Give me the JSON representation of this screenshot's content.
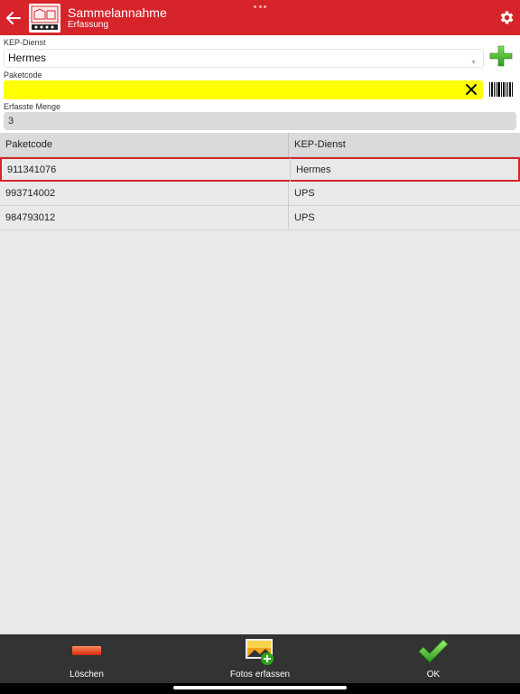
{
  "header": {
    "title": "Sammelannahme",
    "subtitle": "Erfassung",
    "background_color": "#d6242a"
  },
  "form": {
    "kep_label": "KEP-Dienst",
    "kep_value": "Hermes",
    "code_label": "Paketcode",
    "code_value": "",
    "code_highlight_color": "#ffff00",
    "qty_label": "Erfasste Menge",
    "qty_value": "3"
  },
  "table": {
    "columns": [
      "Paketcode",
      "KEP-Dienst"
    ],
    "rows": [
      {
        "code": "911341076",
        "service": "Hermes"
      },
      {
        "code": "993714002",
        "service": "UPS"
      },
      {
        "code": "984793012",
        "service": "UPS"
      }
    ]
  },
  "toolbar": {
    "delete_label": "Löschen",
    "photo_label": "Fotos erfassen",
    "ok_label": "OK"
  },
  "icons": {
    "back": "arrow-left-icon",
    "settings": "gear-icon",
    "add": "plus-icon",
    "clear": "close-icon",
    "barcode": "barcode-icon",
    "delete": "minus-icon",
    "photo": "photo-add-icon",
    "ok": "checkmark-icon"
  }
}
